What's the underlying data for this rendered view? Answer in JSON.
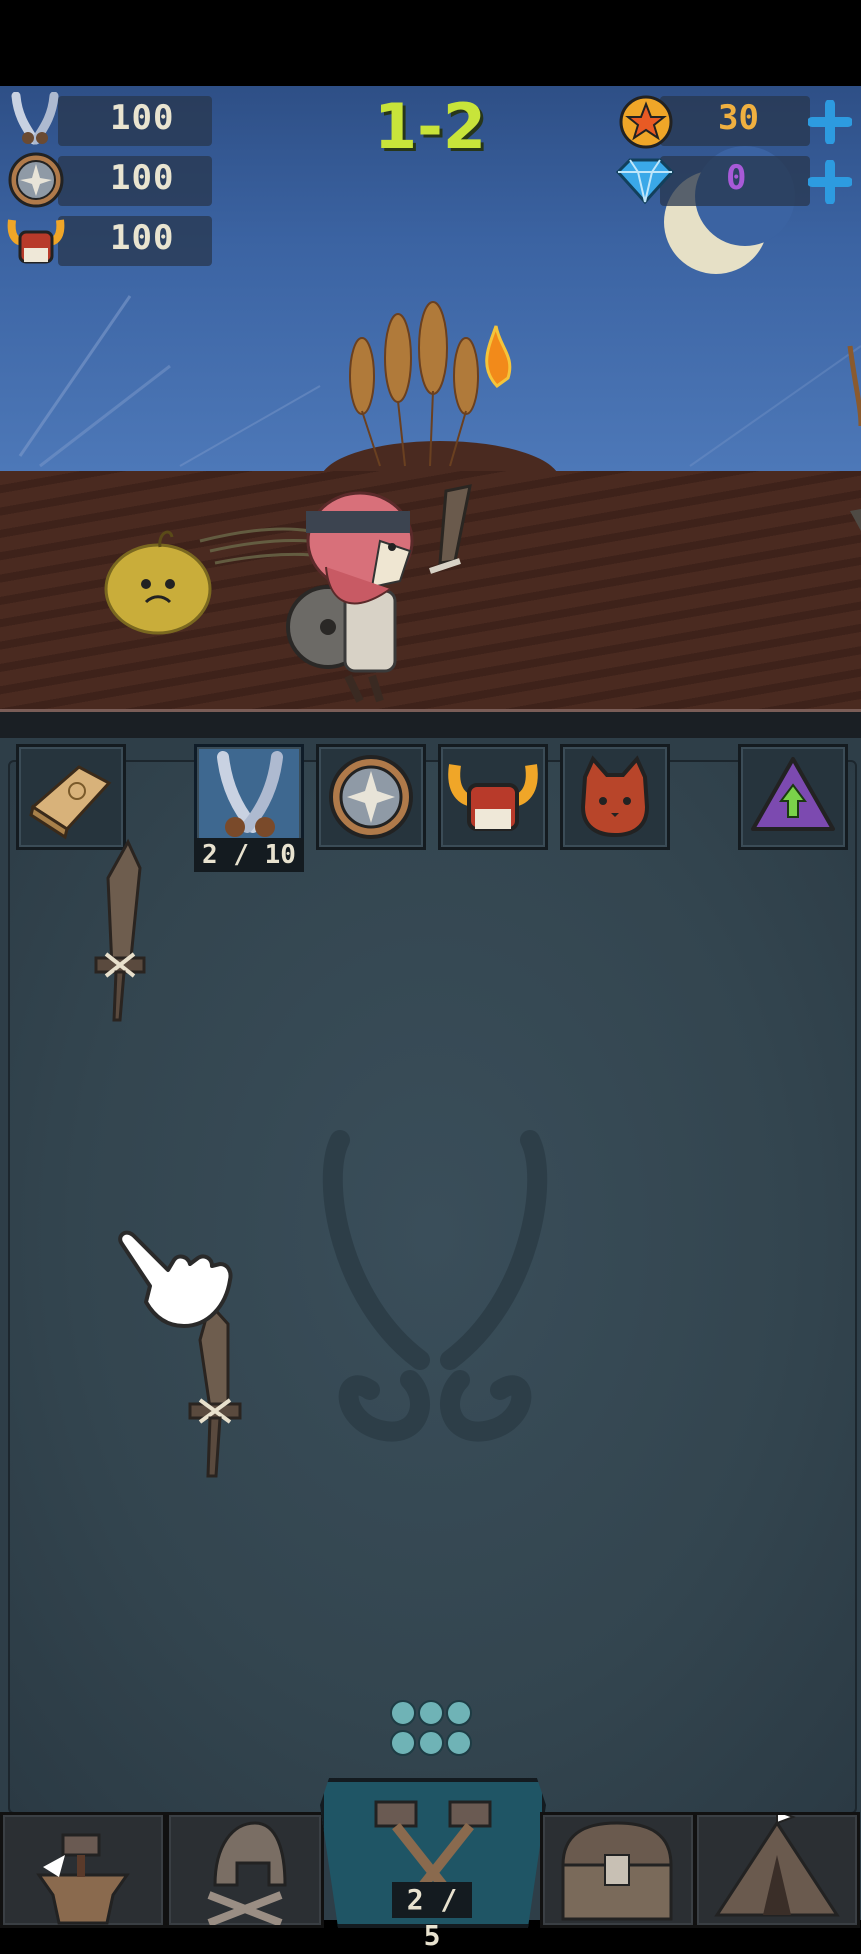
{
  "stats": {
    "attack": {
      "value": "100",
      "icon": "crossed-swords-icon"
    },
    "defense": {
      "value": "100",
      "icon": "round-shield-icon"
    },
    "helmet": {
      "value": "100",
      "icon": "horned-helmet-icon"
    }
  },
  "level": "1-2",
  "currency": {
    "coins": {
      "value": "30",
      "icon": "star-coin-icon",
      "color": "#f0b040"
    },
    "gems": {
      "value": "0",
      "icon": "diamond-icon",
      "color": "#a85ad8"
    }
  },
  "equipment_tabs": [
    {
      "name": "scroll",
      "icon": "scroll-icon"
    },
    {
      "name": "weapons",
      "icon": "crossed-swords-icon",
      "count": "2 / 10",
      "active": true
    },
    {
      "name": "shield",
      "icon": "round-shield-icon"
    },
    {
      "name": "helmet",
      "icon": "horned-helmet-icon"
    },
    {
      "name": "pet",
      "icon": "cat-icon"
    },
    {
      "name": "upgrade",
      "icon": "upgrade-arrow-icon"
    }
  ],
  "merge_counter": "2 / 5",
  "bottom_nav": [
    {
      "name": "forge",
      "icon": "anvil-hammer-icon"
    },
    {
      "name": "heroes",
      "icon": "spartan-helmet-icon"
    },
    {
      "name": "merge",
      "icon": "crossed-hammers-icon",
      "active": true
    },
    {
      "name": "chest",
      "icon": "treasure-chest-icon"
    },
    {
      "name": "camp",
      "icon": "tent-icon"
    }
  ],
  "colors": {
    "level_text": "#c8e43a",
    "plus_button": "#2d9be0",
    "active_tab": "#3e6890",
    "board": "#33454f"
  }
}
